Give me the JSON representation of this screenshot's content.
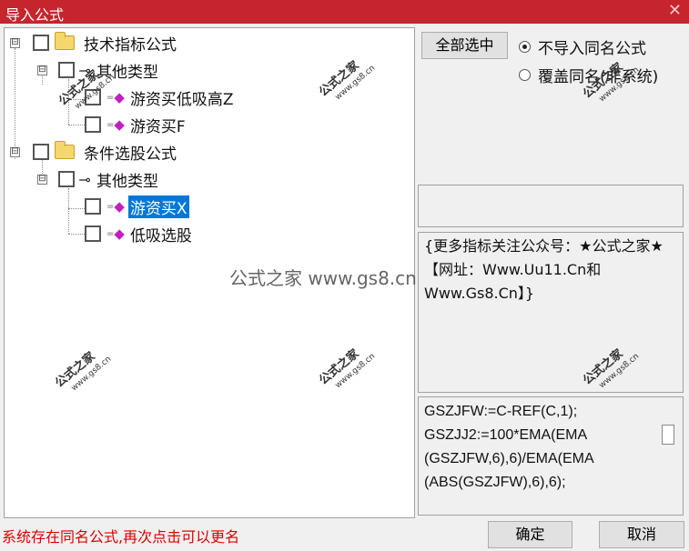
{
  "window": {
    "title": "导入公式",
    "close_glyph": "✕"
  },
  "tree": {
    "nodes": [
      {
        "label": "技术指标公式",
        "expander": "⊟"
      },
      {
        "label": "其他类型",
        "expander": "⊟"
      },
      {
        "label": "游资买低吸高Z"
      },
      {
        "label": "游资买F"
      },
      {
        "label": "条件选股公式",
        "expander": "⊟"
      },
      {
        "label": "其他类型",
        "expander": "⊟"
      },
      {
        "label": "游资买X",
        "selected": true
      },
      {
        "label": "低吸选股"
      }
    ],
    "icons": {
      "key": "⊸",
      "gem": "◆",
      "dashes": "="
    }
  },
  "buttons": {
    "select_all": "全部选中",
    "ok": "确定",
    "cancel": "取消"
  },
  "options": {
    "no_import": "不导入同名公式",
    "overwrite": "覆盖同名(非系统)",
    "selected": "no_import"
  },
  "description": "{更多指标关注公众号：★公式之家★ 【网址：Www.Uu11.Cn和Www.Gs8.Cn】}",
  "code_lines": [
    "GSZJFW:=C-REF(C,1);",
    "GSZJJ2:=100*EMA(EMA",
    "(GSZJFW,6),6)/EMA(EMA",
    "(ABS(GSZJFW),6),6);"
  ],
  "status_message": "系统存在同名公式,再次点击可以更名",
  "watermark": {
    "center": "公式之家 www.gs8.cn",
    "small": "公式之家",
    "small_url": "www.gs8.cn"
  },
  "colors": {
    "titlebar": "#c6252d",
    "selection": "#0078d7",
    "status": "#e00000"
  }
}
